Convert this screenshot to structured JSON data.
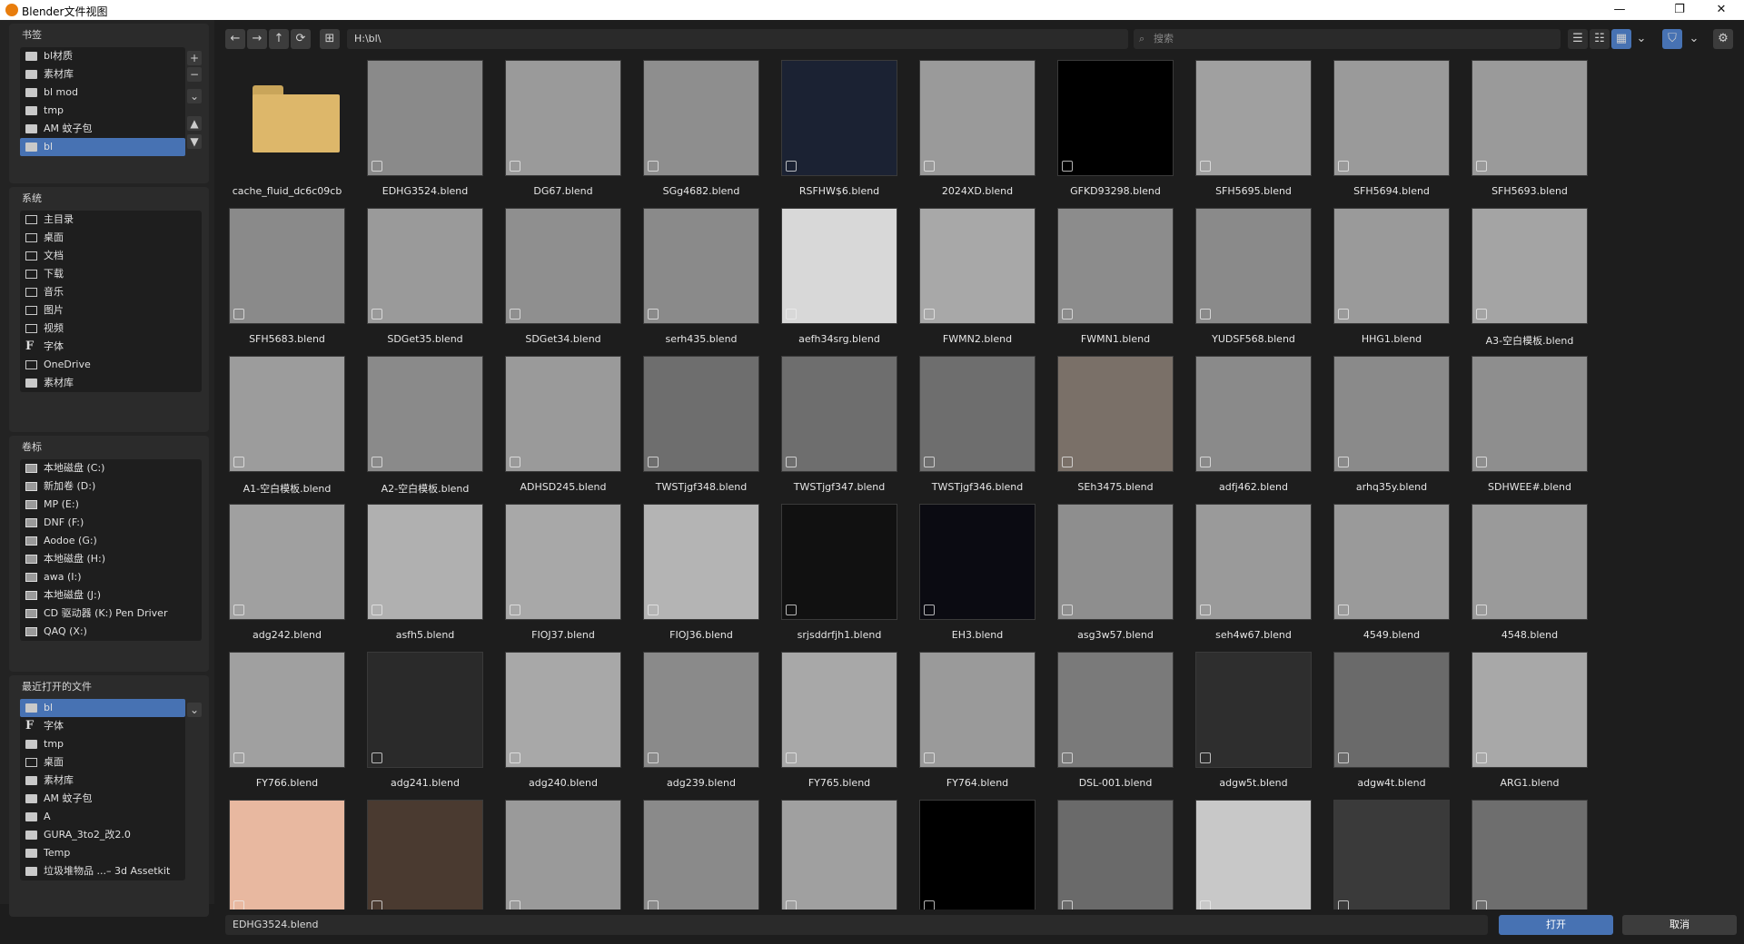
{
  "window": {
    "title": "Blender文件视图",
    "min": "—",
    "max": "❐",
    "close": "✕"
  },
  "sidebar": {
    "bookmarks": {
      "title": "书签",
      "items": [
        "bl材质",
        "素材库",
        "bl   mod",
        "tmp",
        "AM 蚊子包",
        "bl"
      ]
    },
    "system": {
      "title": "系统",
      "items": [
        "主目录",
        "桌面",
        "文档",
        "下载",
        "音乐",
        "图片",
        "视频",
        "字体",
        "OneDrive",
        "素材库"
      ]
    },
    "volumes": {
      "title": "卷标",
      "items": [
        "本地磁盘 (C:)",
        "新加卷 (D:)",
        "MP (E:)",
        "DNF (F:)",
        "Aodoe (G:)",
        "本地磁盘 (H:)",
        "awa (I:)",
        "本地磁盘 (J:)",
        "CD 驱动器 (K:) Pen Driver",
        "QAQ (X:)"
      ]
    },
    "recent": {
      "title": "最近打开的文件",
      "items": [
        "bl",
        "字体",
        "tmp",
        "桌面",
        "素材库",
        "AM 蚊子包",
        "A",
        "GURA_3to2_改2.0",
        "Temp",
        "垃圾堆物品 ...– 3d Assetkit"
      ]
    },
    "add": "+",
    "remove": "−"
  },
  "toolbar": {
    "back": "←",
    "forward": "→",
    "parent": "↑",
    "refresh": "⟳",
    "newdir": "⊞",
    "path": "H:\\bl\\",
    "search_placeholder": "搜索"
  },
  "files": [
    [
      "cache_fluid_dc6c09cb",
      "EDHG3524.blend",
      "DG67.blend",
      "SGg4682.blend",
      "RSFHW$6.blend",
      "2024XD.blend",
      "GFKD93298.blend",
      "SFH5695.blend",
      "SFH5694.blend",
      "SFH5693.blend"
    ],
    [
      "SFH5683.blend",
      "SDGet35.blend",
      "SDGet34.blend",
      "serh435.blend",
      "aefh34srg.blend",
      "FWMN2.blend",
      "FWMN1.blend",
      "YUDSF568.blend",
      "HHG1.blend",
      "A3-空白模板.blend"
    ],
    [
      "A1-空白模板.blend",
      "A2-空白模板.blend",
      "ADHSD245.blend",
      "TWSTjgf348.blend",
      "TWSTjgf347.blend",
      "TWSTjgf346.blend",
      "SEh3475.blend",
      "adfj462.blend",
      "arhq35y.blend",
      "SDHWEE#.blend"
    ],
    [
      "adg242.blend",
      "asfh5.blend",
      "FIOJ37.blend",
      "FIOJ36.blend",
      "srjsddrfjh1.blend",
      "EH3.blend",
      "asg3w57.blend",
      "seh4w67.blend",
      "4549.blend",
      "4548.blend"
    ],
    [
      "FY766.blend",
      "adg241.blend",
      "adg240.blend",
      "adg239.blend",
      "FY765.blend",
      "FY764.blend",
      "DSL-001.blend",
      "adgw5t.blend",
      "adgw4t.blend",
      "ARG1.blend"
    ],
    [
      "",
      "",
      "",
      "",
      "",
      "",
      "",
      "",
      "",
      ""
    ]
  ],
  "bottom": {
    "filename": "EDHG3524.blend",
    "open": "打开",
    "cancel": "取消"
  },
  "colors": {
    "accent": "#4772b3",
    "folder": "#ddb76a"
  }
}
